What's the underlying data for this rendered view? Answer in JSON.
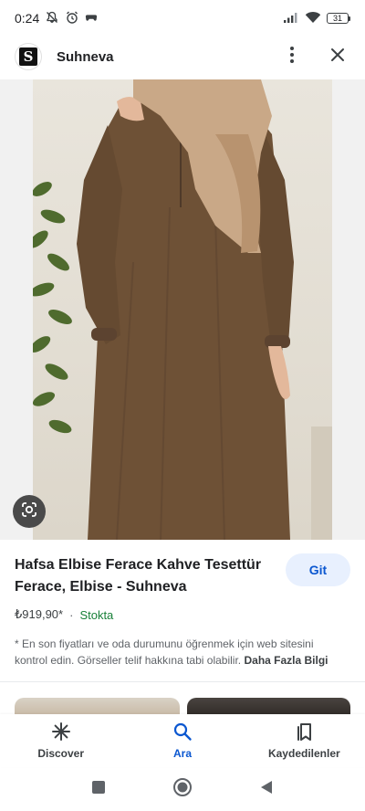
{
  "status_bar": {
    "time": "0:24",
    "battery": "31",
    "icons": [
      "mute-icon",
      "alarm-icon",
      "game-controller-icon",
      "signal-icon",
      "wifi-icon",
      "battery-icon"
    ]
  },
  "header": {
    "logo_letter": "S",
    "site_name": "Suhneva",
    "icons": [
      "more-vert-icon",
      "close-icon"
    ]
  },
  "image": {
    "alt": "Hafsa Elbise Ferace Kahve",
    "lens_icon": "google-lens-icon"
  },
  "product": {
    "title": "Hafsa Elbise Ferace Kahve Tesettür Ferace, Elbise - Suhneva",
    "go_label": "Git",
    "price": "₺919,90*",
    "separator": "·",
    "stock": "Stokta",
    "disclaimer": "* En son fiyatları ve oda durumunu öğrenmek için web sitesini kontrol edin. Görseller telif hakkına tabi olabilir.",
    "more_info": "Daha Fazla Bilgi"
  },
  "bottom_nav": {
    "items": [
      {
        "label": "Discover",
        "icon": "asterisk-icon",
        "active": false
      },
      {
        "label": "Ara",
        "icon": "search-icon",
        "active": true
      },
      {
        "label": "Kaydedilenler",
        "icon": "bookmarks-icon",
        "active": false
      }
    ]
  },
  "system_nav": {
    "icons": [
      "recents-icon",
      "home-icon",
      "back-icon"
    ]
  },
  "colors": {
    "accent": "#0b57d0",
    "accent_bg": "#e8f0fe",
    "stock_green": "#188038",
    "dress_brown": "#6e5136",
    "scarf_beige": "#c9a887"
  }
}
